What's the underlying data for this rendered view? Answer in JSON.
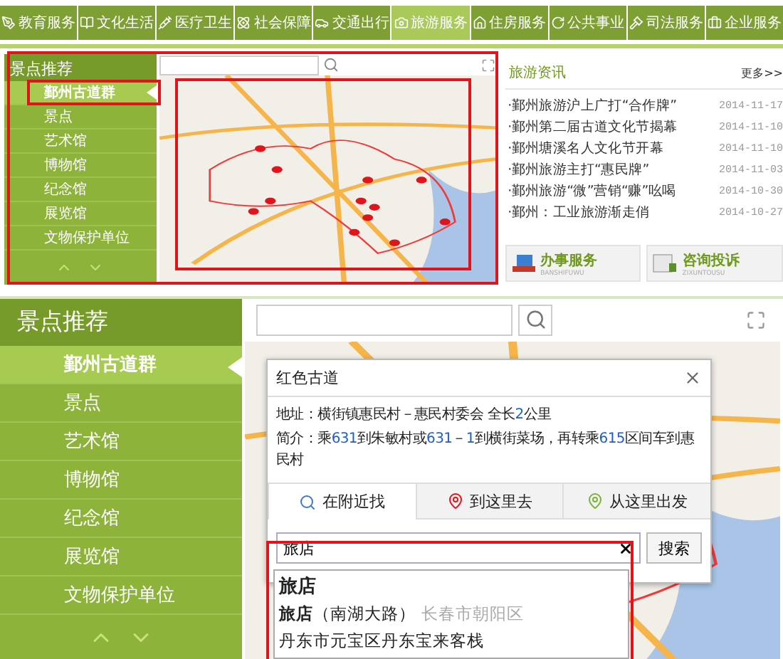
{
  "nav": {
    "items": [
      {
        "label": "教育服务",
        "selected": false
      },
      {
        "label": "文化生活",
        "selected": false
      },
      {
        "label": "医疗卫生",
        "selected": false
      },
      {
        "label": "社会保障",
        "selected": false
      },
      {
        "label": "交通出行",
        "selected": false
      },
      {
        "label": "旅游服务",
        "selected": true
      },
      {
        "label": "住房服务",
        "selected": false
      },
      {
        "label": "公共事业",
        "selected": false
      },
      {
        "label": "司法服务",
        "selected": false
      },
      {
        "label": "企业服务",
        "selected": false
      }
    ]
  },
  "top_panel": {
    "sidebar": {
      "title": "景点推荐",
      "items": [
        {
          "label": "鄞州古道群",
          "selected": true
        },
        {
          "label": "景点",
          "selected": false
        },
        {
          "label": "艺术馆",
          "selected": false
        },
        {
          "label": "博物馆",
          "selected": false
        },
        {
          "label": "纪念馆",
          "selected": false
        },
        {
          "label": "展览馆",
          "selected": false
        },
        {
          "label": "文物保护单位",
          "selected": false
        }
      ]
    },
    "news": {
      "title": "旅游资讯",
      "more": "更多>>",
      "items": [
        {
          "title": "·鄞州旅游沪上广打“合作牌”",
          "date": "2014-11-17"
        },
        {
          "title": "·鄞州第二届古道文化节揭幕",
          "date": "2014-11-10"
        },
        {
          "title": "·鄞州塘溪名人文化节开幕",
          "date": "2014-11-10"
        },
        {
          "title": "·鄞州旅游主打“惠民牌”",
          "date": "2014-11-03"
        },
        {
          "title": "·鄞州旅游“微”营销“赚”吆喝",
          "date": "2014-10-30"
        },
        {
          "title": "·鄞州：工业旅游渐走俏",
          "date": "2014-10-27"
        }
      ]
    },
    "services": [
      {
        "label": "办事服务",
        "sublabel": "BANSHIFUWU"
      },
      {
        "label": "咨询投诉",
        "sublabel": "ZIXUNTOUSU"
      }
    ]
  },
  "bottom_panel": {
    "sidebar": {
      "title": "景点推荐",
      "items": [
        {
          "label": "鄞州古道群",
          "selected": true
        },
        {
          "label": "景点",
          "selected": false
        },
        {
          "label": "艺术馆",
          "selected": false
        },
        {
          "label": "博物馆",
          "selected": false
        },
        {
          "label": "纪念馆",
          "selected": false
        },
        {
          "label": "展览馆",
          "selected": false
        },
        {
          "label": "文物保护单位",
          "selected": false
        }
      ]
    },
    "popup": {
      "title": "红色古道",
      "address": "地址：横街镇惠民村－惠民村委会 全长2公里",
      "intro": "简介：乘631到朱敏村或631－1到横街菜场，再转乘615区间车到惠民村",
      "tabs": [
        {
          "label": "在附近找",
          "selected": true
        },
        {
          "label": "到这里去",
          "selected": false
        },
        {
          "label": "从这里出发",
          "selected": false
        }
      ],
      "search": {
        "value": "旅店",
        "button": "搜索"
      },
      "suggestions": [
        {
          "kind": "keyword",
          "text": "旅店"
        },
        {
          "kind": "place",
          "text": "**旅店**（南湖大路）",
          "area": "长春市朝阳区"
        },
        {
          "kind": "place",
          "text": "丹东市元宝区丹东宝来客栈"
        }
      ]
    }
  }
}
